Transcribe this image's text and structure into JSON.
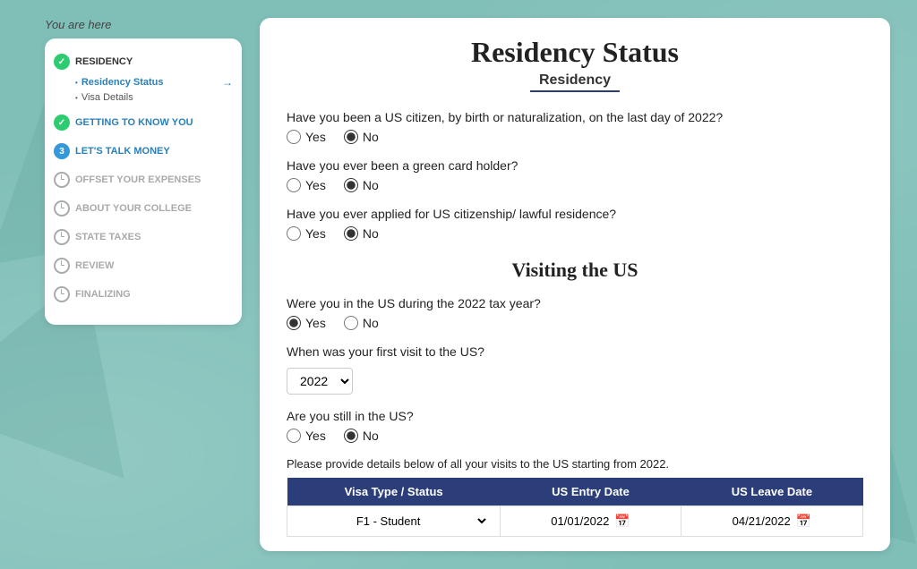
{
  "page": {
    "title": "Residency Status",
    "subtitle": "Residency",
    "you_are_here": "You are here"
  },
  "sidebar": {
    "sections": [
      {
        "id": "residency",
        "label": "RESIDENCY",
        "status": "check",
        "sub_items": [
          {
            "label": "Residency Status",
            "active": true
          },
          {
            "label": "Visa Details",
            "active": false
          }
        ]
      },
      {
        "id": "getting-to-know-you",
        "label": "GETTING TO KNOW YOU",
        "status": "check",
        "sub_items": []
      },
      {
        "id": "lets-talk-money",
        "label": "LET'S TALK MONEY",
        "status": "num",
        "num": "3",
        "sub_items": []
      },
      {
        "id": "offset-your-expenses",
        "label": "OFFSET YOUR EXPENSES",
        "status": "clock",
        "sub_items": []
      },
      {
        "id": "about-your-college",
        "label": "ABOUT YOUR COLLEGE",
        "status": "clock",
        "sub_items": []
      },
      {
        "id": "state-taxes",
        "label": "STATE TAXES",
        "status": "clock",
        "sub_items": []
      },
      {
        "id": "review",
        "label": "REVIEW",
        "status": "clock",
        "sub_items": []
      },
      {
        "id": "finalizing",
        "label": "FINALIZING",
        "status": "clock",
        "sub_items": []
      }
    ]
  },
  "questions": {
    "q1": {
      "text": "Have you been a US citizen, by birth or naturalization, on the last day of 2022?",
      "yes_selected": false,
      "no_selected": true
    },
    "q2": {
      "text": "Have you ever been a green card holder?",
      "yes_selected": false,
      "no_selected": true
    },
    "q3": {
      "text": "Have you ever applied for US citizenship/ lawful residence?",
      "yes_selected": false,
      "no_selected": true
    },
    "visiting_header": "Visiting the US",
    "q4": {
      "text": "Were you in the US during the 2022 tax year?",
      "yes_selected": true,
      "no_selected": false
    },
    "q5": {
      "text": "When was your first visit to the US?",
      "year_value": "2022"
    },
    "q6": {
      "text": "Are you still in the US?",
      "yes_selected": false,
      "no_selected": true
    },
    "table_desc": "Please provide details below of all your visits to the US starting from 2022.",
    "table": {
      "headers": [
        "Visa Type / Status",
        "US Entry Date",
        "US Leave Date"
      ],
      "rows": [
        {
          "visa_type": "F1 - Student",
          "entry_date": "01/01/2022",
          "leave_date": "04/21/2022"
        }
      ]
    }
  }
}
